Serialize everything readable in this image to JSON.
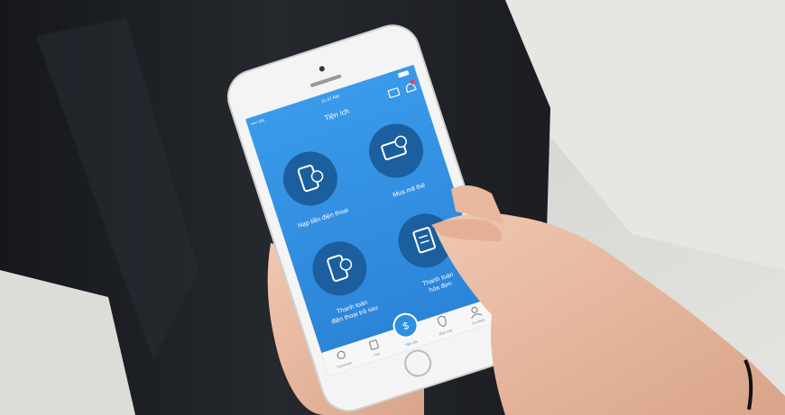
{
  "status_bar": {
    "carrier": "•••• VN",
    "time": "11:47 AM",
    "battery_color": "#ffffff"
  },
  "app": {
    "title": "Tiện ích",
    "header_icons": [
      "card-icon",
      "bell-icon"
    ],
    "features": [
      {
        "label_line1": "Nạp tiền điện thoại",
        "label_line2": "",
        "icon": "phone-refresh-icon"
      },
      {
        "label_line1": "Mua mã thẻ",
        "label_line2": "",
        "icon": "card-dollar-icon"
      },
      {
        "label_line1": "Thanh toán",
        "label_line2": "điện thoại trả sau",
        "icon": "phone-dollar-icon"
      },
      {
        "label_line1": "Thanh toán",
        "label_line2": "hóa đơn",
        "icon": "receipt-icon"
      }
    ],
    "tab_bar": [
      {
        "label": "Tài khoản",
        "icon": "account-icon"
      },
      {
        "label": "Thẻ",
        "icon": "wallet-icon"
      },
      {
        "label": "Tiện ích",
        "icon": "dollar-circle-icon",
        "active": true
      },
      {
        "label": "Bảo mật",
        "icon": "shield-icon"
      },
      {
        "label": "Cá nhân",
        "icon": "person-icon"
      }
    ]
  },
  "colors": {
    "screen_blue": "#2f8fe0",
    "circle_blue": "#1b5f9e",
    "sofa": "#d9d9d6",
    "jeans": "#1f2125",
    "skin": "#e7b9a0"
  }
}
